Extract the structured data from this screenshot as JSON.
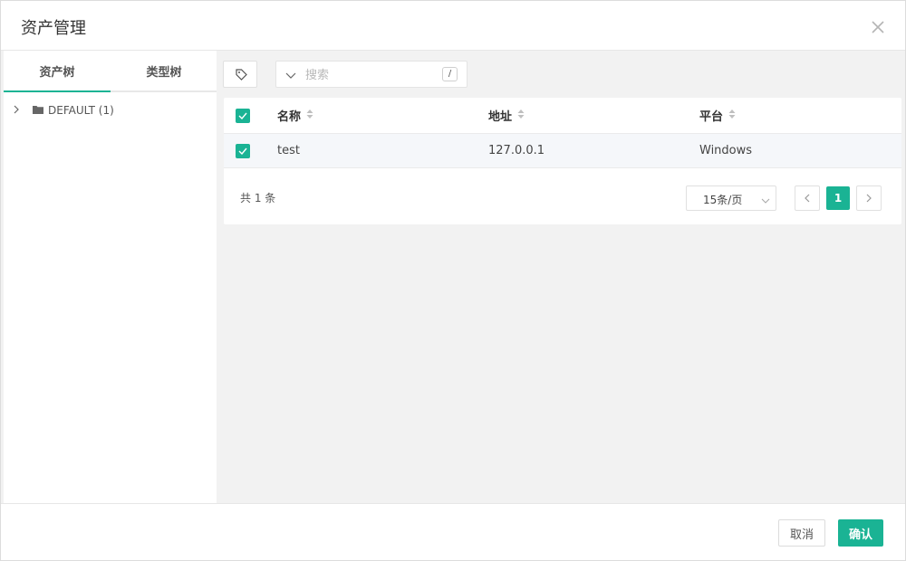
{
  "dialog": {
    "title": "资产管理",
    "close_icon": "close-icon"
  },
  "tabs": [
    {
      "label": "资产树",
      "active": true
    },
    {
      "label": "类型树",
      "active": false
    }
  ],
  "tree": {
    "nodes": [
      {
        "label": "DEFAULT (1)",
        "icon": "folder-icon",
        "expanded": false
      }
    ]
  },
  "toolbar": {
    "tag_icon": "tag-icon",
    "search_placeholder": "搜索",
    "search_value": "",
    "shortcut_key": "/"
  },
  "table": {
    "columns": [
      "名称",
      "地址",
      "平台"
    ],
    "header_checked": true,
    "rows": [
      {
        "checked": true,
        "name": "test",
        "address": "127.0.0.1",
        "platform": "Windows"
      }
    ]
  },
  "pagination": {
    "total_text": "共 1 条",
    "page_size": "15条/页",
    "current_page": "1"
  },
  "footer": {
    "cancel_label": "取消",
    "confirm_label": "确认"
  },
  "colors": {
    "accent": "#1ab394",
    "background": "#f2f2f2"
  }
}
